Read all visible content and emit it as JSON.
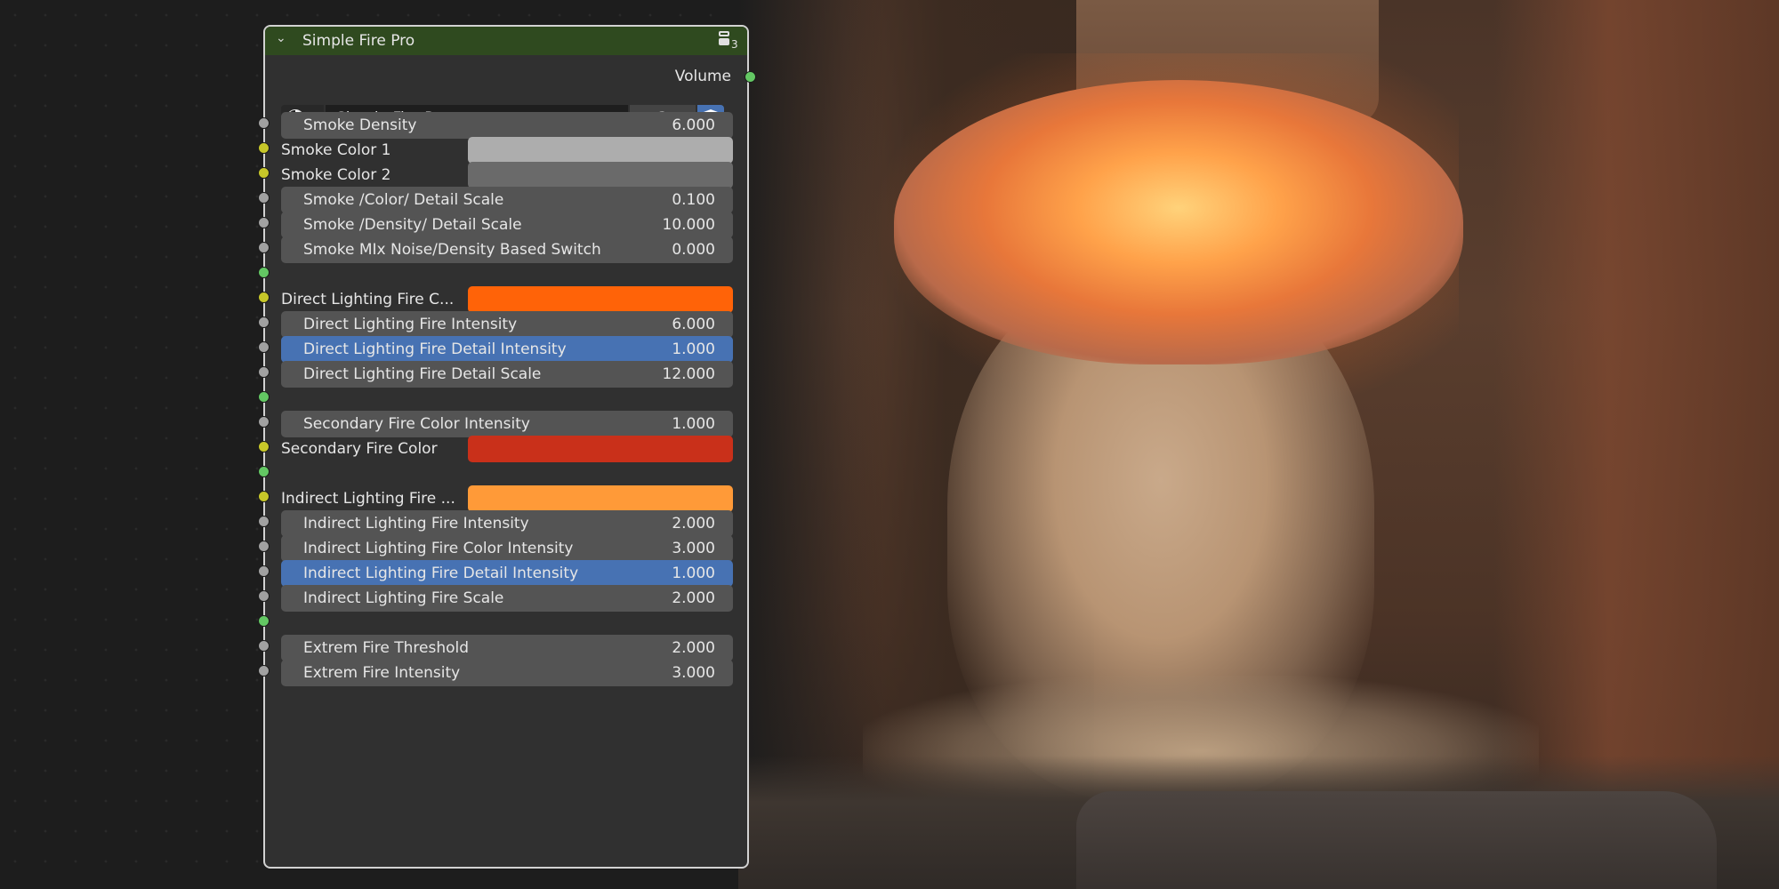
{
  "node": {
    "title": "Simple Fire Pro",
    "user_count": "3",
    "output_label": "Volume",
    "datablock": {
      "name": "Simple Fire Pro",
      "users": "3"
    }
  },
  "fields": {
    "smoke_density": {
      "label": "Smoke Density",
      "value": "6.000"
    },
    "smoke_color_1": {
      "label": "Smoke Color 1",
      "color": "#adadad"
    },
    "smoke_color_2": {
      "label": "Smoke Color 2",
      "color": "#6a6a6a"
    },
    "smoke_color_detail_scale": {
      "label": "Smoke /Color/ Detail Scale",
      "value": "0.100"
    },
    "smoke_density_detail_scale": {
      "label": "Smoke /Density/ Detail Scale",
      "value": "10.000"
    },
    "smoke_mix_switch": {
      "label": "Smoke MIx Noise/Density Based Switch",
      "value": "0.000"
    },
    "direct_fire_color": {
      "label": "Direct Lighting Fire C...",
      "color": "#ff6308"
    },
    "direct_fire_intensity": {
      "label": "Direct Lighting Fire Intensity",
      "value": "6.000"
    },
    "direct_fire_detail_intensity": {
      "label": "Direct Lighting Fire Detail Intensity",
      "value": "1.000"
    },
    "direct_fire_detail_scale": {
      "label": "Direct Lighting Fire Detail Scale",
      "value": "12.000"
    },
    "secondary_fire_color_intensity": {
      "label": "Secondary Fire Color Intensity",
      "value": "1.000"
    },
    "secondary_fire_color": {
      "label": "Secondary Fire Color",
      "color": "#c9301a"
    },
    "indirect_fire_color": {
      "label": "Indirect Lighting Fire ...",
      "color": "#ff9a38"
    },
    "indirect_fire_intensity": {
      "label": "Indirect Lighting Fire Intensity",
      "value": "2.000"
    },
    "indirect_fire_color_intensity": {
      "label": "Indirect Lighting Fire Color Intensity",
      "value": "3.000"
    },
    "indirect_fire_detail_intensity": {
      "label": "Indirect Lighting Fire Detail Intensity",
      "value": "1.000"
    },
    "indirect_fire_scale": {
      "label": "Indirect Lighting Fire Scale",
      "value": "2.000"
    },
    "extrem_fire_threshold": {
      "label": "Extrem Fire Threshold",
      "value": "2.000"
    },
    "extrem_fire_intensity": {
      "label": "Extrem Fire Intensity",
      "value": "3.000"
    }
  },
  "colors": {
    "header_green": "#2f4a1f",
    "active_field": "#4772b3",
    "socket_float": "#a1a1a1",
    "socket_color": "#c7c729",
    "socket_shader": "#63c763"
  }
}
